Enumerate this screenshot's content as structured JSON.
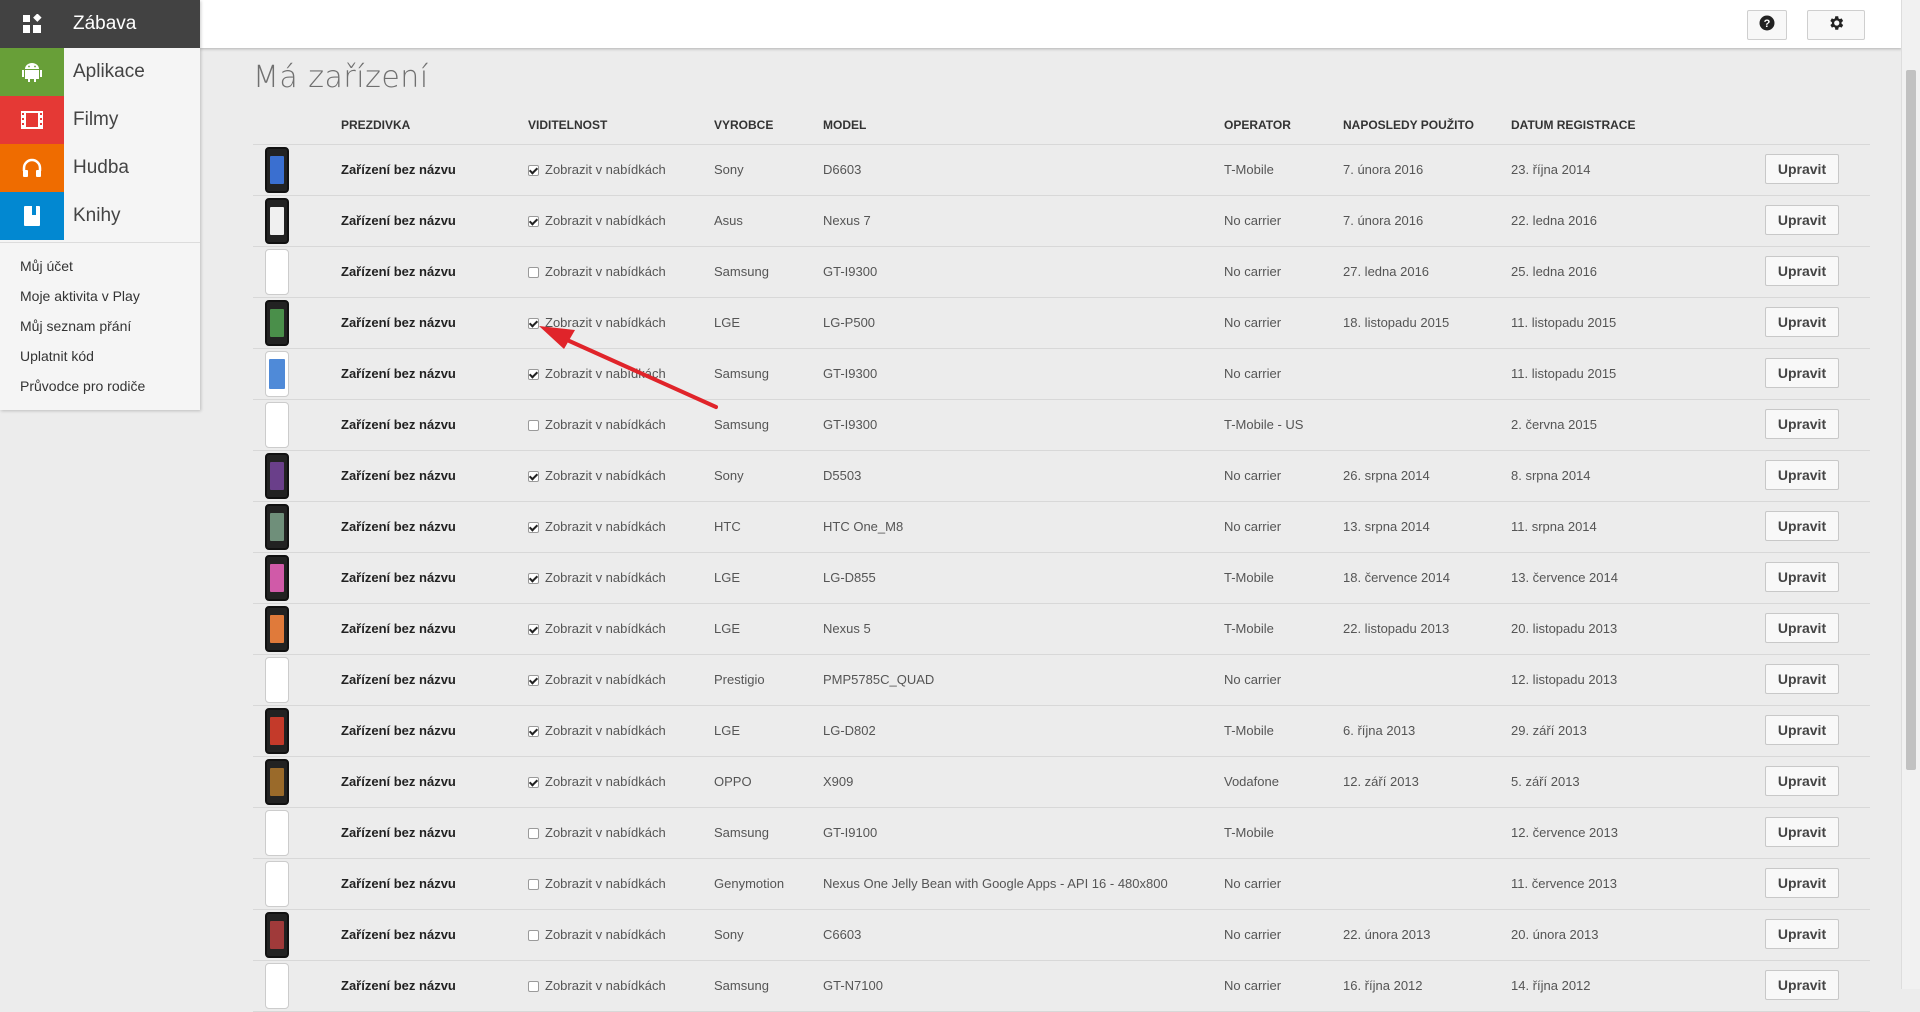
{
  "sidebar": {
    "nav": [
      {
        "label": "Zábava",
        "icon": "grid-icon"
      },
      {
        "label": "Aplikace",
        "icon": "android-icon"
      },
      {
        "label": "Filmy",
        "icon": "film-icon"
      },
      {
        "label": "Hudba",
        "icon": "headphones-icon"
      },
      {
        "label": "Knihy",
        "icon": "book-icon"
      }
    ],
    "links": [
      "Můj účet",
      "Moje aktivita v Play",
      "Můj seznam přání",
      "Uplatnit kód",
      "Průvodce pro rodiče"
    ]
  },
  "topbar": {
    "help_icon": "help-icon",
    "settings_icon": "gear-icon"
  },
  "page": {
    "title": "Má zařízení"
  },
  "table": {
    "headers": [
      "PREZDIVKA",
      "VIDITELNOST",
      "VYROBCE",
      "MODEL",
      "OPERATOR",
      "NAPOSLEDY POUŽITO",
      "DATUM REGISTRACE"
    ],
    "visibility_label": "Zobrazit v nabídkách",
    "edit_label": "Upravit",
    "rows": [
      {
        "name": "Zařízení bez názvu",
        "visible": true,
        "maker": "Sony",
        "model": "D6603",
        "operator": "T-Mobile",
        "last_used": "7. února 2016",
        "registered": "23. října 2014",
        "phone": "dark",
        "screen": "#3a6fd0"
      },
      {
        "name": "Zařízení bez názvu",
        "visible": true,
        "maker": "Asus",
        "model": "Nexus 7",
        "operator": "No carrier",
        "last_used": "7. února 2016",
        "registered": "22. ledna 2016",
        "phone": "dark",
        "screen": "#f0f0f0"
      },
      {
        "name": "Zařízení bez názvu",
        "visible": false,
        "maker": "Samsung",
        "model": "GT-I9300",
        "operator": "No carrier",
        "last_used": "27. ledna 2016",
        "registered": "25. ledna 2016",
        "phone": "white",
        "screen": ""
      },
      {
        "name": "Zařízení bez názvu",
        "visible": true,
        "maker": "LGE",
        "model": "LG-P500",
        "operator": "No carrier",
        "last_used": "18. listopadu 2015",
        "registered": "11. listopadu 2015",
        "phone": "dark",
        "screen": "#4a8f4a"
      },
      {
        "name": "Zařízení bez názvu",
        "visible": true,
        "maker": "Samsung",
        "model": "GT-I9300",
        "operator": "No carrier",
        "last_used": "",
        "registered": "11. listopadu 2015",
        "phone": "white",
        "screen": "#4f8ad8"
      },
      {
        "name": "Zařízení bez názvu",
        "visible": false,
        "maker": "Samsung",
        "model": "GT-I9300",
        "operator": "T-Mobile - US",
        "last_used": "",
        "registered": "2. června 2015",
        "phone": "white",
        "screen": ""
      },
      {
        "name": "Zařízení bez názvu",
        "visible": true,
        "maker": "Sony",
        "model": "D5503",
        "operator": "No carrier",
        "last_used": "26. srpna 2014",
        "registered": "8. srpna 2014",
        "phone": "dark",
        "screen": "#6a3f8a"
      },
      {
        "name": "Zařízení bez názvu",
        "visible": true,
        "maker": "HTC",
        "model": "HTC One_M8",
        "operator": "No carrier",
        "last_used": "13. srpna 2014",
        "registered": "11. srpna 2014",
        "phone": "dark",
        "screen": "#6f8f7a"
      },
      {
        "name": "Zařízení bez názvu",
        "visible": true,
        "maker": "LGE",
        "model": "LG-D855",
        "operator": "T-Mobile",
        "last_used": "18. července 2014",
        "registered": "13. července 2014",
        "phone": "dark",
        "screen": "#d05aa8"
      },
      {
        "name": "Zařízení bez názvu",
        "visible": true,
        "maker": "LGE",
        "model": "Nexus 5",
        "operator": "T-Mobile",
        "last_used": "22. listopadu 2013",
        "registered": "20. listopadu 2013",
        "phone": "dark",
        "screen": "#e07a3a"
      },
      {
        "name": "Zařízení bez názvu",
        "visible": true,
        "maker": "Prestigio",
        "model": "PMP5785C_QUAD",
        "operator": "No carrier",
        "last_used": "",
        "registered": "12. listopadu 2013",
        "phone": "white",
        "screen": ""
      },
      {
        "name": "Zařízení bez názvu",
        "visible": true,
        "maker": "LGE",
        "model": "LG-D802",
        "operator": "T-Mobile",
        "last_used": "6. října 2013",
        "registered": "29. září 2013",
        "phone": "dark",
        "screen": "#c43a2a"
      },
      {
        "name": "Zařízení bez názvu",
        "visible": true,
        "maker": "OPPO",
        "model": "X909",
        "operator": "Vodafone",
        "last_used": "12. září 2013",
        "registered": "5. září 2013",
        "phone": "dark",
        "screen": "#9a6a2a"
      },
      {
        "name": "Zařízení bez názvu",
        "visible": false,
        "maker": "Samsung",
        "model": "GT-I9100",
        "operator": "T-Mobile",
        "last_used": "",
        "registered": "12. července 2013",
        "phone": "white",
        "screen": ""
      },
      {
        "name": "Zařízení bez názvu",
        "visible": false,
        "maker": "Genymotion",
        "model": "Nexus One Jelly Bean with Google Apps - API 16 - 480x800",
        "operator": "No carrier",
        "last_used": "",
        "registered": "11. července 2013",
        "phone": "white",
        "screen": ""
      },
      {
        "name": "Zařízení bez názvu",
        "visible": false,
        "maker": "Sony",
        "model": "C6603",
        "operator": "No carrier",
        "last_used": "22. února 2013",
        "registered": "20. února 2013",
        "phone": "dark",
        "screen": "#a03a3a"
      },
      {
        "name": "Zařízení bez názvu",
        "visible": false,
        "maker": "Samsung",
        "model": "GT-N7100",
        "operator": "No carrier",
        "last_used": "16. října 2012",
        "registered": "14. října 2012",
        "phone": "white",
        "screen": ""
      }
    ]
  }
}
